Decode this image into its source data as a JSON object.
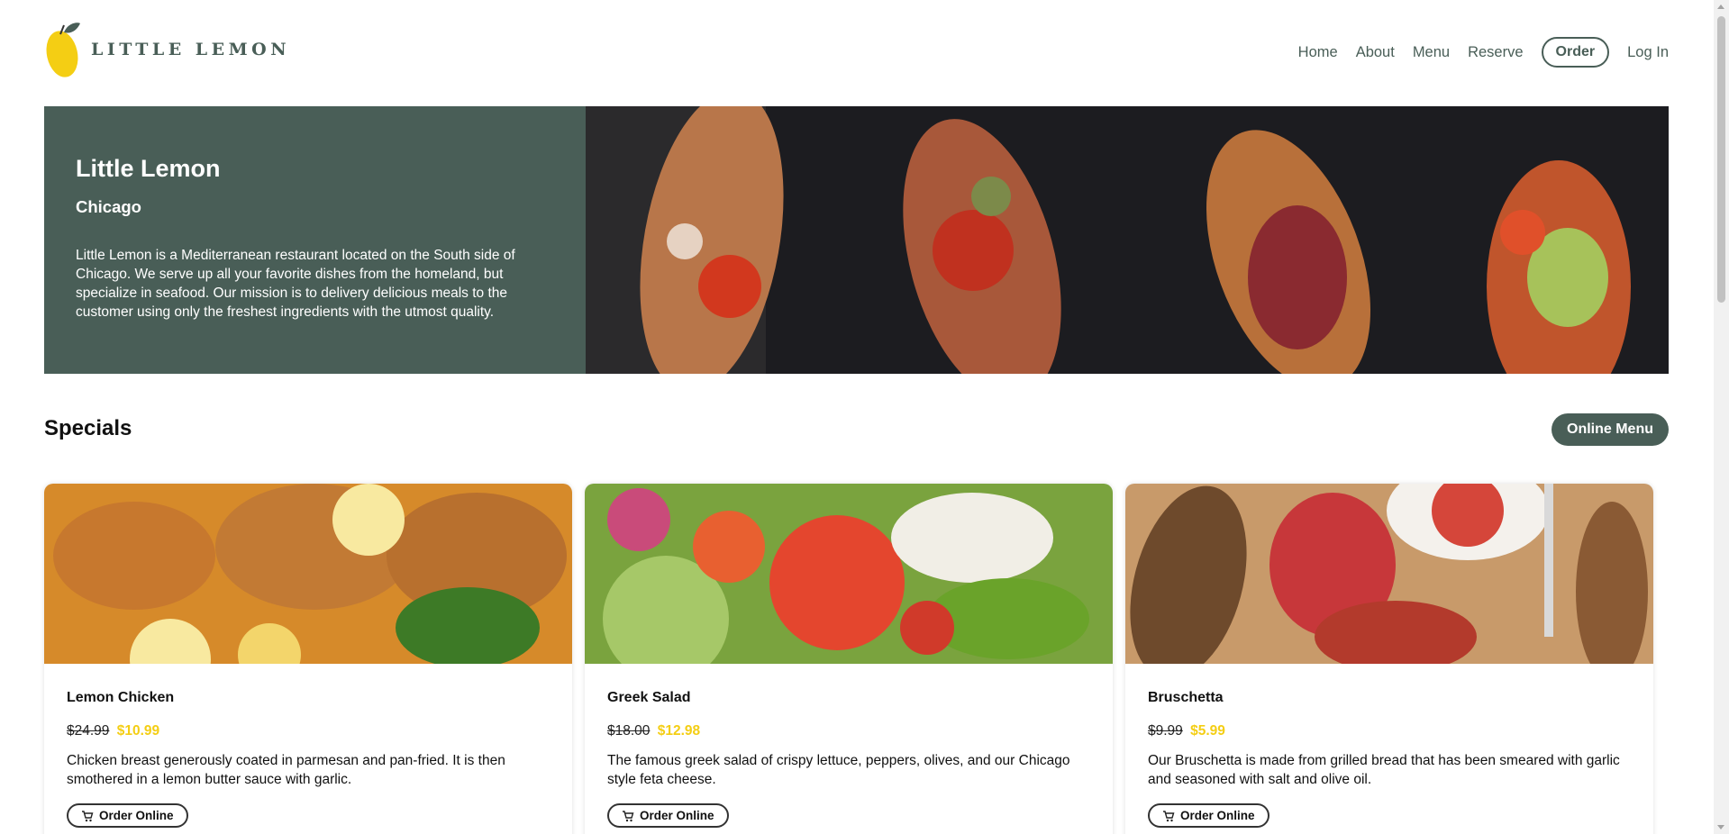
{
  "brand": {
    "name": "LITTLE LEMON",
    "logo_icon": "lemon-icon",
    "accent": "#495e57",
    "highlight": "#f4ce14"
  },
  "nav": {
    "items": [
      "Home",
      "About",
      "Menu",
      "Reserve"
    ],
    "order_label": "Order",
    "login_label": "Log In"
  },
  "hero": {
    "title": "Little Lemon",
    "city": "Chicago",
    "description": "Little Lemon is a Mediterranean restaurant located on the South side of Chicago. We serve up all your favorite dishes from the homeland, but specialize in seafood. Our mission is to delivery delicious meals to the customer using only the freshest ingredients with the utmost quality."
  },
  "specials": {
    "title": "Specials",
    "button_label": "Online Menu",
    "cards": [
      {
        "title": "Lemon Chicken",
        "old_price": "$24.99",
        "price": "$10.99",
        "description": "Chicken breast generously coated in parmesan and pan-fried. It is then smothered in a lemon butter sauce with garlic.",
        "button_label": "Order Online"
      },
      {
        "title": "Greek Salad",
        "old_price": "$18.00",
        "price": "$12.98",
        "description": "The famous greek salad of crispy lettuce, peppers, olives, and our Chicago style feta cheese.",
        "button_label": "Order Online"
      },
      {
        "title": "Bruschetta",
        "old_price": "$9.99",
        "price": "$5.99",
        "description": "Our Bruschetta is made from grilled bread that has been smeared with garlic and seasoned with salt and olive oil.",
        "button_label": "Order Online"
      }
    ]
  }
}
